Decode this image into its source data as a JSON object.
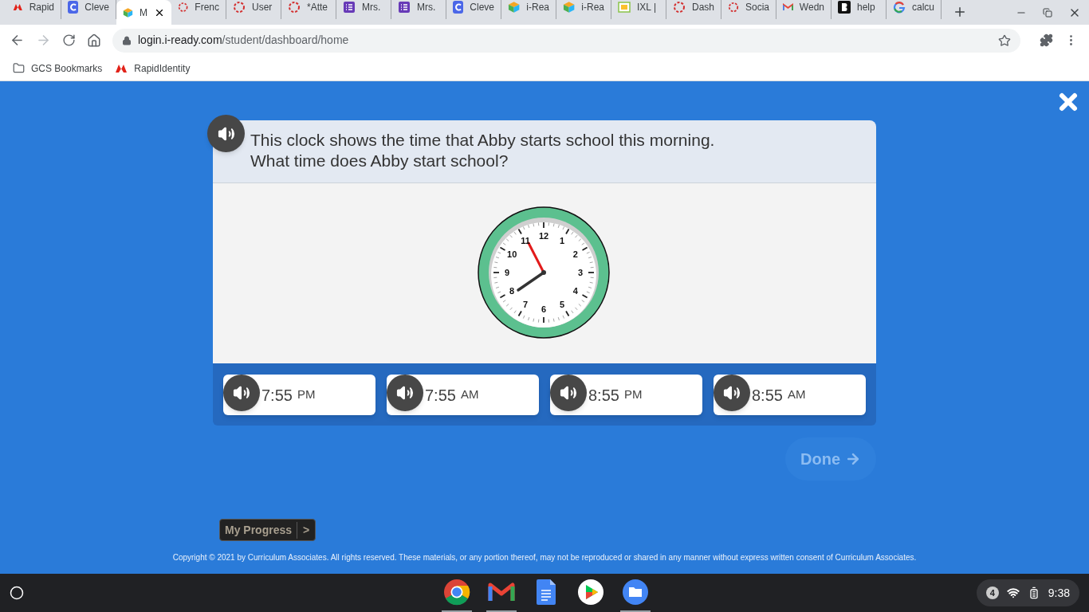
{
  "browser": {
    "tabs": [
      {
        "kind": "rapid",
        "title": "Rapid",
        "selected": false
      },
      {
        "kind": "clever",
        "title": "Cleve",
        "selected": false
      },
      {
        "kind": "cube",
        "title": "M",
        "selected": true
      },
      {
        "kind": "ring",
        "title": "Frenc",
        "selected": false
      },
      {
        "kind": "ring",
        "title": "User",
        "selected": false
      },
      {
        "kind": "ring",
        "title": "*Atte",
        "selected": false
      },
      {
        "kind": "list",
        "title": "Mrs.",
        "selected": false
      },
      {
        "kind": "list",
        "title": "Mrs.",
        "selected": false
      },
      {
        "kind": "clever",
        "title": "Cleve",
        "selected": false
      },
      {
        "kind": "cube",
        "title": "i-Rea",
        "selected": false
      },
      {
        "kind": "cube",
        "title": "i-Rea",
        "selected": false
      },
      {
        "kind": "ixl",
        "title": "IXL |",
        "selected": false
      },
      {
        "kind": "ring",
        "title": "Dash",
        "selected": false
      },
      {
        "kind": "ring",
        "title": "Socia",
        "selected": false
      },
      {
        "kind": "mail",
        "title": "Wedn",
        "selected": false
      },
      {
        "kind": "bold",
        "title": "help",
        "selected": false
      },
      {
        "kind": "google",
        "title": "calcu",
        "selected": false
      }
    ],
    "url": {
      "host": "login.i-ready.com",
      "path": "/student/dashboard/home"
    },
    "bookmarks": [
      {
        "kind": "folder",
        "label": "GCS Bookmarks"
      },
      {
        "kind": "rapid",
        "label": "RapidIdentity"
      }
    ]
  },
  "question": {
    "lines": [
      "This clock shows the time that Abby starts school this morning.",
      "What time does Abby start school?"
    ],
    "clock_numbers": [
      "12",
      "1",
      "2",
      "3",
      "4",
      "5",
      "6",
      "7",
      "8",
      "9",
      "10",
      "11"
    ]
  },
  "answers": [
    {
      "time": "7:55",
      "suffix": "PM"
    },
    {
      "time": "7:55",
      "suffix": "AM"
    },
    {
      "time": "8:55",
      "suffix": "PM"
    },
    {
      "time": "8:55",
      "suffix": "AM"
    }
  ],
  "done": {
    "label": "Done",
    "disabled": true
  },
  "progress": {
    "label": "My Progress",
    "arrow": ">"
  },
  "copyright": "Copyright © 2021 by Curriculum Associates. All rights reserved. These materials, or any portion thereof, may not be reproduced or shared in any manner without express written consent of Curriculum Associates.",
  "taskbar": {
    "apps": [
      {
        "kind": "chrome",
        "running": true
      },
      {
        "kind": "gmail",
        "running": true
      },
      {
        "kind": "docs",
        "running": false
      },
      {
        "kind": "play",
        "running": false
      },
      {
        "kind": "files",
        "running": true
      }
    ],
    "notifications": "4",
    "time": "9:38"
  }
}
